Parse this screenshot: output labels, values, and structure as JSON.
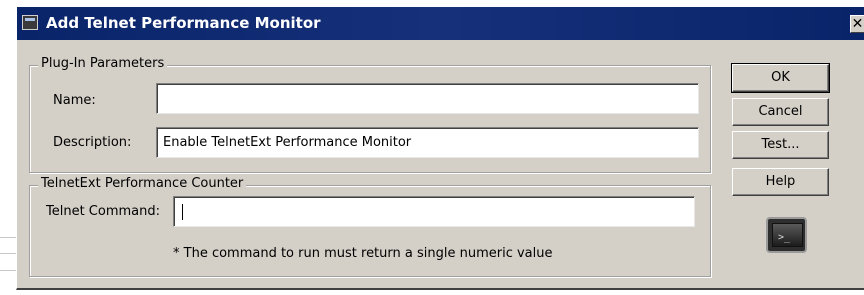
{
  "window": {
    "title": "Add Telnet Performance Monitor",
    "close_glyph": "✕",
    "icon": "terminal-icon"
  },
  "plugin_params": {
    "legend": "Plug-In Parameters",
    "name_label": "Name:",
    "name_value": "",
    "description_label": "Description:",
    "description_value": "Enable TelnetExt Performance Monitor"
  },
  "counter": {
    "legend": "TelnetExt Performance Counter",
    "command_label": "Telnet Command:",
    "command_value": "",
    "note": "* The command to run must return a single numeric value"
  },
  "buttons": {
    "ok": "OK",
    "cancel": "Cancel",
    "test": "Test...",
    "help": "Help"
  },
  "icons": {
    "plugin_icon": "terminal-monitor-icon"
  },
  "colors": {
    "titlebar": "#0a246a",
    "dialog_bg": "#d4d0c8"
  }
}
